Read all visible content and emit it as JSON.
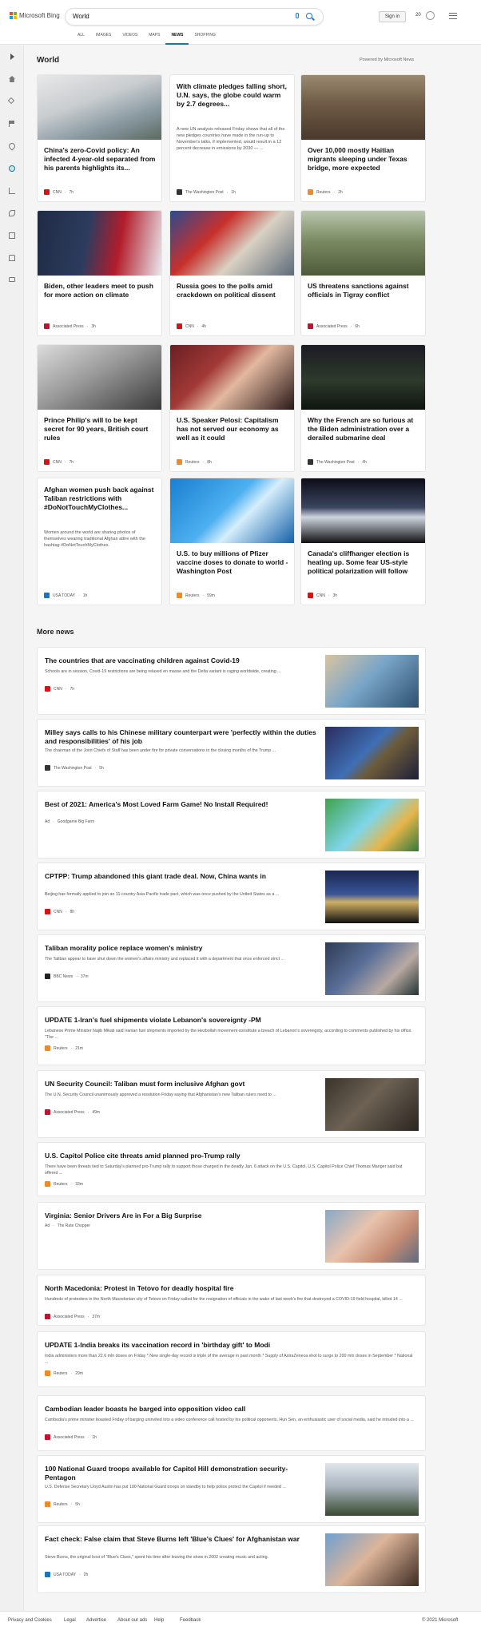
{
  "header": {
    "brand": "Microsoft Bing",
    "search_value": "World",
    "sign_in": "Sign in",
    "rewards_count": "20",
    "tabs": [
      "ALL",
      "IMAGES",
      "VIDEOS",
      "MAPS",
      "NEWS",
      "SHOPPING"
    ],
    "active_tab": "NEWS"
  },
  "section": {
    "title": "World",
    "powered_by": "Powered by Microsoft News",
    "more_title": "More news"
  },
  "cards": [
    {
      "title": "China's zero-Covid policy: An infected 4-year-old separated from his parents highlights its...",
      "source": "CNN",
      "time": "7h",
      "color": "#d11"
    },
    {
      "title": "With climate pledges falling short, U.N. says, the globe could warm by 2.7 degrees...",
      "snippet": "A new UN analysis released Friday shows that all of the new pledges countries have made in the run-up to November's talks, if implemented, would result in a 12 percent decrease in emissions by 2030 — ...",
      "source": "The Washington Post",
      "time": "1h",
      "color": "#333"
    },
    {
      "title": "Over 10,000 mostly Haitian migrants sleeping under Texas bridge, more expected",
      "source": "Reuters",
      "time": "2h",
      "color": "#f08a24"
    },
    {
      "title": "Biden, other leaders meet to push for more action on climate",
      "source": "Associated Press",
      "time": "3h",
      "color": "#c8102e"
    },
    {
      "title": "Russia goes to the polls amid crackdown on political dissent",
      "source": "CNN",
      "time": "4h",
      "color": "#d11"
    },
    {
      "title": "US threatens sanctions against officials in Tigray conflict",
      "source": "Associated Press",
      "time": "6h",
      "color": "#c8102e"
    },
    {
      "title": "Prince Philip's will to be kept secret for 90 years, British court rules",
      "source": "CNN",
      "time": "7h",
      "color": "#d11"
    },
    {
      "title": "U.S. Speaker Pelosi: Capitalism has not served our economy as well as it could",
      "source": "Reuters",
      "time": "8h",
      "color": "#f08a24"
    },
    {
      "title": "Why the French are so furious at the Biden administration over a derailed submarine deal",
      "source": "The Washington Post",
      "time": "4h",
      "color": "#333"
    },
    {
      "title": "Afghan women push back against Taliban restrictions with #DoNotTouchMyClothes...",
      "snippet": "Women around the world are sharing photos of themselves wearing traditional Afghan attire with the hashtag #DoNotTouchMyClothes.",
      "source": "USA TODAY",
      "time": "1h",
      "color": "#1e73be"
    },
    {
      "title": "U.S. to buy millions of Pfizer vaccine doses to donate to world -Washington Post",
      "source": "Reuters",
      "time": "59m",
      "color": "#f08a24"
    },
    {
      "title": "Canada's cliffhanger election is heating up. Some fear US-style political polarization will follow",
      "source": "CNN",
      "time": "3h",
      "color": "#d11"
    }
  ],
  "more": [
    {
      "title": "The countries that are vaccinating children against Covid-19",
      "snippet": "Schools are in session, Covid-19 restrictions are being relaxed en masse and the Delta variant is raging worldwide, creating ...",
      "source": "CNN",
      "time": "7h",
      "color": "#d11"
    },
    {
      "title": "Milley says calls to his Chinese military counterpart were 'perfectly within the duties and responsibilities' of his job",
      "snippet": "The chairman of the Joint Chiefs of Staff has been under fire for private conversations in the closing months of the Trump ...",
      "source": "The Washington Post",
      "time": "5h",
      "color": "#333"
    },
    {
      "title": "Best of 2021: America's Most Loved Farm Game! No Install Required!",
      "ad": "Ad",
      "source": "Goodgame Big Farm",
      "time": "",
      "color": ""
    },
    {
      "title": "CPTPP: Trump abandoned this giant trade deal. Now, China wants in",
      "snippet": "Beijing has formally applied to join an 11-country Asia-Pacific trade pact, which was once pushed by the United States as a ...",
      "source": "CNN",
      "time": "8h",
      "color": "#d11"
    },
    {
      "title": "Taliban morality police replace women's ministry",
      "snippet": "The Taliban appear to have shut down the women's affairs ministry and replaced it with a department that once enforced strict ...",
      "source": "BBC News",
      "time": "37m",
      "color": "#222"
    },
    {
      "title": "UPDATE 1-Iran's fuel shipments violate Lebanon's sovereignty -PM",
      "snippet": "Lebanese Prime Minister Najib Mikati said Iranian fuel shipments imported by the Hezbollah movement constitute a breach of Lebanon's sovereignty, according to comments published by his office. \"The ...",
      "source": "Reuters",
      "time": "21m",
      "color": "#f08a24"
    },
    {
      "title": "UN Security Council: Taliban must form inclusive Afghan govt",
      "snippet": "The U.N. Security Council unanimously approved a resolution Friday saying that Afghanistan's new Taliban rulers need to ...",
      "source": "Associated Press",
      "time": "49m",
      "color": "#c8102e"
    },
    {
      "title": "U.S. Capitol Police cite threats amid planned pro-Trump rally",
      "snippet": "There have been threats tied to Saturday's planned pro-Trump rally to support those charged in the deadly Jan. 6 attack on the U.S. Capitol, U.S. Capitol Police Chief Thomas Manger said but offered ...",
      "source": "Reuters",
      "time": "33m",
      "color": "#f08a24"
    },
    {
      "title": "Virginia: Senior Drivers Are in For a Big Surprise",
      "ad": "Ad",
      "source": "The Rate Chopper",
      "time": "",
      "color": ""
    },
    {
      "title": "North Macedonia: Protest in Tetovo for deadly hospital fire",
      "snippet": "Hundreds of protesters in the North Macedonian city of Tetovo on Friday called for the resignation of officials in the wake of last week's fire that destroyed a COVID-19 field hospital, killed 14 ...",
      "source": "Associated Press",
      "time": "37m",
      "color": "#c8102e"
    },
    {
      "title": "UPDATE 1-India breaks its vaccination record in 'birthday gift' to Modi",
      "snippet": "India administers more than 22.6 mln doses on Friday * New single-day record is triple of the average in past month * Supply of AstraZeneca shot to surge to 200 mln doses in September * National ...",
      "source": "Reuters",
      "time": "29m",
      "color": "#f08a24"
    },
    {
      "title": "Cambodian leader boasts he barged into opposition video call",
      "snippet": "Cambodia's prime minister boasted Friday of barging uninvited into a video conference call hosted by his political opponents. Hun Sen, an enthusiastic user of social media, said he intruded into a ...",
      "source": "Associated Press",
      "time": "1h",
      "color": "#c8102e"
    },
    {
      "title": "100 National Guard troops available for Capitol Hill demonstration security-Pentagon",
      "snippet": "U.S. Defense Secretary Lloyd Austin has put 100 National Guard troops on standby to help police protect the Capitol if needed ...",
      "source": "Reuters",
      "time": "5h",
      "color": "#f08a24"
    },
    {
      "title": "Fact check: False claim that Steve Burns left 'Blue's Clues' for Afghanistan war",
      "snippet": "Steve Burns, the original host of \"Blue's Clues,\" spent his time after leaving the show in 2002 creating music and acting.",
      "source": "USA TODAY",
      "time": "2h",
      "color": "#1e73be"
    }
  ],
  "footer": {
    "links": [
      "Privacy and Cookies",
      "Legal",
      "Advertise",
      "About our ads",
      "Help",
      "Feedback"
    ],
    "copyright": "© 2021 Microsoft"
  }
}
